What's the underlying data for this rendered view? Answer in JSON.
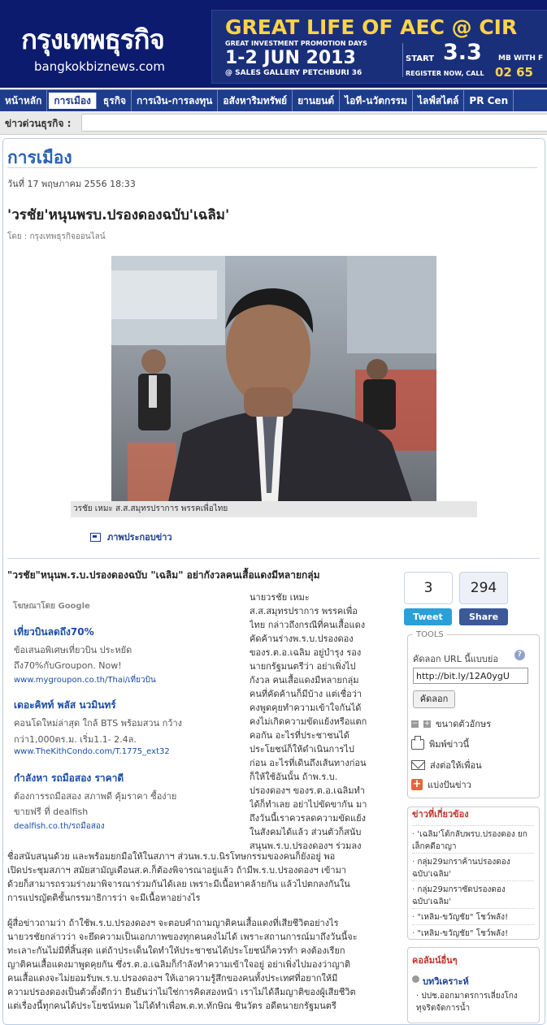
{
  "header": {
    "logo_title": "กรุงเทพธุรกิจ",
    "logo_url": "bangkokbiznews.com",
    "banner": {
      "title": "GREAT LIFE OF AEC @ CIR",
      "subtitle": "GREAT INVESTMENT PROMOTION DAYS",
      "dates": "1-2 JUN 2013",
      "venue": "@ SALES GALLERY PETCHBURI 36",
      "start": "START",
      "speed": "3.3",
      "speed_unit": "MB WITH F",
      "register": "REGISTER NOW, CALL",
      "phone": "02 65"
    }
  },
  "nav": {
    "items": [
      {
        "label": "หน้าหลัก",
        "active": false
      },
      {
        "label": "การเมือง",
        "active": true
      },
      {
        "label": "ธุรกิจ",
        "active": false
      },
      {
        "label": "การเงิน-การลงทุน",
        "active": false
      },
      {
        "label": "อสังหาริมทรัพย์",
        "active": false
      },
      {
        "label": "ยานยนต์",
        "active": false
      },
      {
        "label": "ไอที-นวัตกรรม",
        "active": false
      },
      {
        "label": "ไลฟ์สไตล์",
        "active": false
      },
      {
        "label": "PR Cen",
        "active": false
      }
    ]
  },
  "breaking": {
    "label": "ข่าวด่วนธุรกิจ :"
  },
  "article": {
    "section": "การเมือง",
    "date": "วันที่ 17 พฤษภาคม 2556 18:33",
    "headline": "'วรชัย'หนุนพรบ.ปรองดองฉบับ'เฉลิม'",
    "byline": "โดย : กรุงเทพธุรกิจออนไลน์",
    "caption": "วรชัย เหมะ ส.ส.สมุทรปราการ พรรคเพื่อไทย",
    "gallery_label": "ภาพประกอบข่าว",
    "subhead": "\"วรชัย\"หนุนพ.ร.บ.ปรองดองฉบับ \"เฉลิม\" อย่ากังวลคนเสื้อแดงมีหลายกลุ่ม",
    "narrow_lines": [
      "นายวรชัย เหมะ",
      "ส.ส.สมุทรปราการ พรรคเพื่อ",
      "ไทย กล่าวถึงกรณีที่คนเสื้อแดง",
      "คัดค้านร่างพ.ร.บ.ปรองดอง",
      "ของร.ต.อ.เฉลิม อยู่บำรุง รอง",
      "นายกรัฐมนตรีว่า อย่าเพิ่งไป",
      "กังวล คนเสื้อแดงมีหลายกลุ่ม",
      "คนที่คัดค้านก็มีบ้าง แต่เชื่อว่า",
      "คงพูดคุยทำความเข้าใจกันได้",
      "คงไม่เกิดความขัดแย้งหรือแตก",
      "คอกัน อะไรที่ประชาชนได้",
      "ประโยชน์ก็ให้ดำเนินการไป",
      "ก่อน อะไรที่เดินถึงเส้นทางก่อน",
      "ก็ให้ใช้อันนั้น ถ้าพ.ร.บ.",
      "ปรองดองฯ ของร.ต.อ.เฉลิมทำ",
      "ได้ก็ทำเลย อย่าไปขัดขากัน มา",
      "ถึงวันนี้เราควรลดความขัดแย้ง",
      "ในสังคมได้แล้ว ส่วนตัวก็สนับ",
      "สนุนพ.ร.บ.ปรองดองฯ ร่วมลง"
    ],
    "para1_lines": [
      "ชื่อสนับสนุนด้วย และพร้อมยกมือให้ในสภาฯ ส่วนพ.ร.บ.นิรโทษกรรมของคนก็ยังอยู่ พอ",
      "เปิดประชุมสภาฯ สมัยสามัญเดือนส.ค.ก็ต้องพิจารณาอยู่แล้ว ถ้ามีพ.ร.บ.ปรองดองฯ เข้ามา",
      "ด้วยก็สามารถรวมร่างมาพิจารณาร่วมกันได้เลย เพราะมีเนื้อหาคล้ายกัน แล้วไปตกลงกันใน",
      "การแปรญัตติชั้นกรรมาธิการว่า จะมีเนื้อหาอย่างไร"
    ],
    "para2_lines": [
      "ผู้สื่อข่าวถามว่า ถ้าใช้พ.ร.บ.ปรองดองฯ จะตอบคำถามญาติคนเสื้อแดงที่เสียชีวิตอย่างไร",
      "นายวรชัยกล่าวว่า จะยึดความเป็นเอกภาพของทุกคนคงไม่ได้ เพราะสถานการณ์มาถึงวันนี้จะ",
      "ทะเลาะกันไม่มีที่สิ้นสุด แต่ถ้าประเด็นใดทำให้ประชาชนได้ประโยชน์ก็ควรทำ คงต้องเรียก",
      "ญาติคนเสื้อแดงมาพูดคุยกัน ซึ่งร.ต.อ.เฉลิมก็กำลังทำความเข้าใจอยู่ อย่าเพิ่งไปมองว่าญาติ",
      "คนเสื้อแดงจะไม่ยอมรับพ.ร.บ.ปรองดองฯ ให้เอาความรู้สึกของคนทั้งประเทศที่อยากให้มี",
      "ความปรองดองเป็นตัวตั้งดีกว่า ยืนยันว่าไม่ใช่การคิดสองหน้า เราไม่ได้ลืมญาติของผู้เสียชีวิต",
      "แต่เรื่องนี้ทุกคนได้ประโยชน์หมด ไม่ได้ทำเพื่อพ.ต.ท.ทักษิณ ชินวัตร อดีตนายกรัฐมนตรี"
    ]
  },
  "ads": {
    "label": "โฆษณาโดย Google",
    "items": [
      {
        "title": "เที่ยวบินลดถึง70%",
        "lines": [
          "ข้อเสนอพิเศษเที่ยวบิน ประหยัด",
          "ถึง70%กับGroupon. Now!"
        ],
        "url": "www.mygroupon.co.th/Thai/เที่ยวบิน"
      },
      {
        "title": "เดอะคิทท์ พลัส นวมินทร์",
        "lines": [
          "คอนโดใหม่ล่าสุด ใกล้ BTS พร้อมสวน กว้าง",
          "กว่า1,000ตร.ม. เริ่ม1.1- 2.4ล."
        ],
        "url": "www.TheKithCondo.com/T.1775_ext32"
      },
      {
        "title": "กำลังหา รถมือสอง ราคาดี",
        "lines": [
          "ต้องการรถมือสอง สภาพดี คุ้มราคา ซื้อง่าย",
          "ขายฟรี ที่ dealfish"
        ],
        "url": "dealfish.co.th/รถมือสอง"
      }
    ]
  },
  "sidebar": {
    "tweet_count": "3",
    "share_count": "294",
    "tweet_label": "Tweet",
    "share_label": "Share",
    "tools_label": "TOOLS",
    "copy_url_label": "คัดลอก URL นี้แบบย่อ",
    "short_url": "http://bit.ly/12A0ygU",
    "copy_button": "คัดลอก",
    "font_size_label": "ขนาดตัวอักษร",
    "print_label": "พิมพ์ข่าวนี้",
    "send_label": "ส่งต่อให้เพื่อน",
    "share_news_label": "แบ่งปันข่าว",
    "related_title": "ข่าวที่เกี่ยวข้อง",
    "related": [
      "'เฉลิม'โต้กลับพรบ.ปรองดอง ยกเล็กคดีอาญา",
      "กลุ่ม29มกราค้านปรองดองฉบับ'เฉลิม'",
      "กลุ่ม29มกราซัดปรองดองฉบับ'เฉลิม'",
      "\"เหลิม-ขวัญชัย\" โชว์พลัง!",
      "\"เหลิม-ขวัญชัย\" โชว์พลัง!"
    ],
    "popular_title": "คอลัมน์อื่นๆ",
    "popular_sub": "บทวิเคราะห์",
    "popular_items": [
      "ปปช.ออกมาตรการเลี่ยงโกงทุจริตจัดการน้ำ"
    ]
  }
}
